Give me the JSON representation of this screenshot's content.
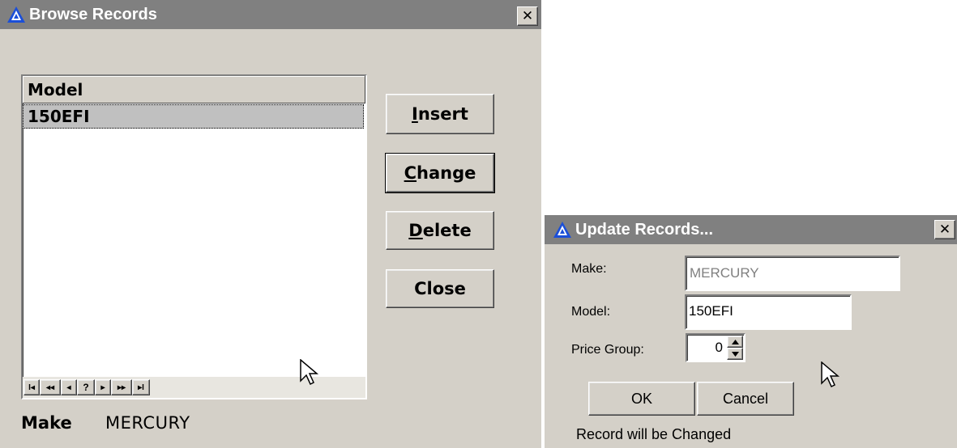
{
  "browse": {
    "title": "Browse Records",
    "close_glyph": "✕",
    "column_header": "Model",
    "rows": [
      "150EFI"
    ],
    "nav": [
      "I◂",
      "◂◂",
      "◂",
      "?",
      "▸",
      "▸▸",
      "▸I"
    ],
    "buttons": {
      "insert": {
        "mn": "I",
        "rest": "nsert"
      },
      "change": {
        "mn": "C",
        "rest": "hange"
      },
      "delete": {
        "mn": "D",
        "rest": "elete"
      },
      "close": "Close"
    },
    "make_label": "Make",
    "make_value": "MERCURY"
  },
  "update": {
    "title": "Update Records...",
    "close_glyph": "✕",
    "make_label": "Make:",
    "make_value": "MERCURY",
    "model_label": "Model:",
    "model_value": "150EFI",
    "price_group_label": "Price Group:",
    "price_group_value": "0",
    "ok": "OK",
    "cancel": "Cancel",
    "status": "Record will be Changed"
  },
  "colors": {
    "dialog_bg": "#d4d0c8",
    "titlebar_inactive": "#808080",
    "selection": "#c0c0c0",
    "disabled_text": "#808080"
  },
  "icons": [
    "app-icon",
    "close-icon",
    "mouse-pointer-icon",
    "spin-up-icon",
    "spin-down-icon"
  ]
}
